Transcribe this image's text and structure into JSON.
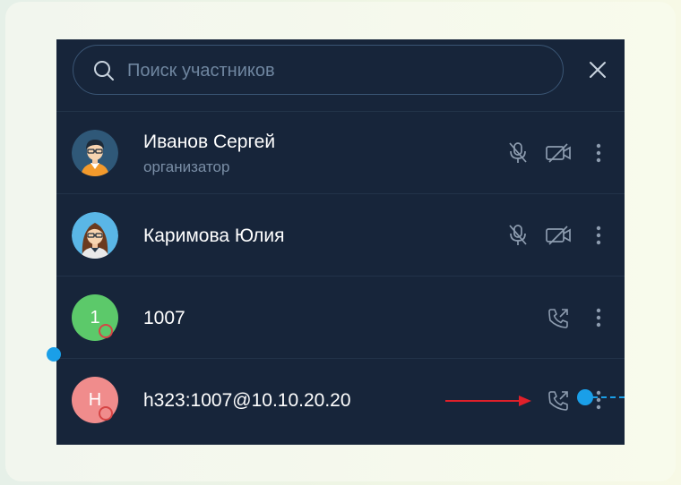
{
  "search": {
    "placeholder": "Поиск участников"
  },
  "participants": [
    {
      "name": "Иванов Сергей",
      "role": "организатор",
      "avatar": "man-avatar"
    },
    {
      "name": "Каримова Юлия",
      "role": "",
      "avatar": "woman-avatar"
    },
    {
      "name": "1007",
      "initial": "1",
      "avatar_color": "#5cc96a"
    },
    {
      "name": "h323:1007@10.10.20.20",
      "initial": "H",
      "avatar_color": "#f08c8c"
    }
  ],
  "icons": {
    "mic": "mic-off-icon",
    "camera": "camera-off-icon",
    "call": "outgoing-call-icon",
    "more": "more-vertical-icon",
    "close": "close-icon",
    "search": "search-icon"
  },
  "colors": {
    "panel_bg": "#17253a",
    "accent_blue": "#1a9fe8",
    "annotation_red": "#e0202a"
  }
}
